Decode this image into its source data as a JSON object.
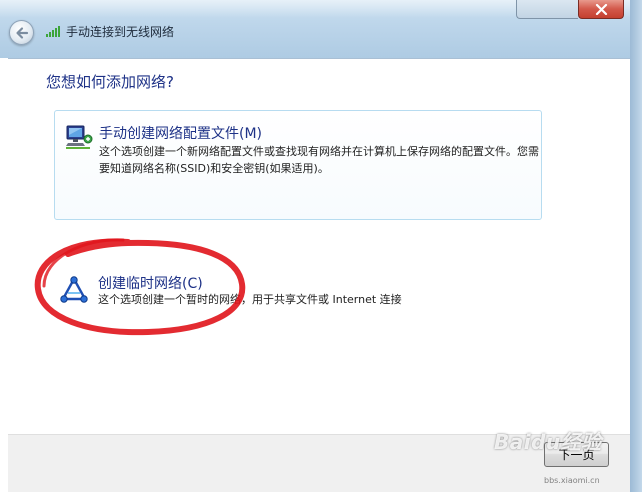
{
  "window": {
    "title": "手动连接到无线网络"
  },
  "page": {
    "question": "您想如何添加网络?"
  },
  "options": [
    {
      "title": "手动创建网络配置文件(M)",
      "description": "这个选项创建一个新网络配置文件或查找现有网络并在计算机上保存网络的配置文件。您需要知道网络名称(SSID)和安全密钥(如果适用)。",
      "icon": "network-computer-icon"
    },
    {
      "title": "创建临时网络(C)",
      "description": "这个选项创建一个暂时的网络，用于共享文件或 Internet 连接",
      "icon": "adhoc-network-icon"
    }
  ],
  "footer": {
    "next_label": "下一页"
  },
  "annotation": {
    "color": "#e0141b"
  },
  "watermark": {
    "brand": "Baidu经验",
    "url": "bbs.xiaomi.cn"
  }
}
